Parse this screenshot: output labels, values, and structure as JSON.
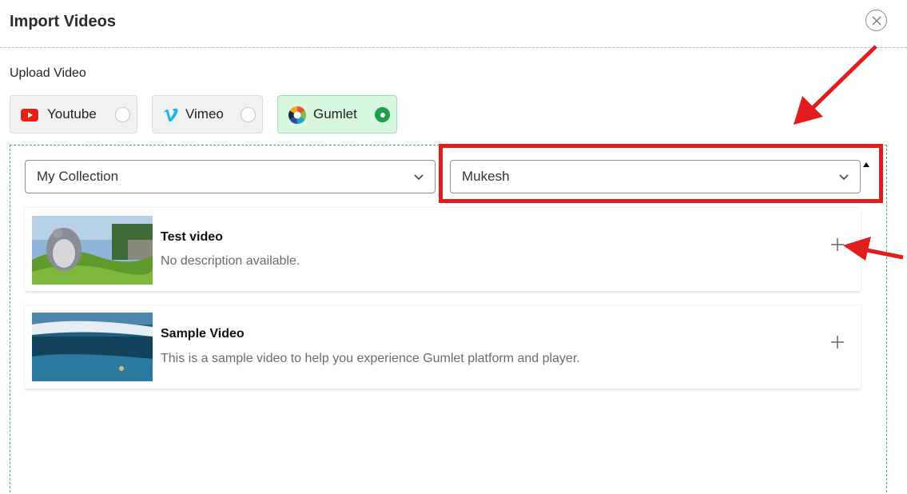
{
  "modal": {
    "title": "Import Videos",
    "close_icon": "close-icon"
  },
  "upload": {
    "label": "Upload Video",
    "sources": [
      {
        "label": "Youtube",
        "icon": "youtube-icon",
        "selected": false
      },
      {
        "label": "Vimeo",
        "icon": "vimeo-icon",
        "selected": false
      },
      {
        "label": "Gumlet",
        "icon": "gumlet-icon",
        "selected": true
      }
    ]
  },
  "filters": {
    "collection": "My Collection",
    "user": "Mukesh"
  },
  "videos": [
    {
      "title": "Test video",
      "description": "No description available."
    },
    {
      "title": "Sample Video",
      "description": "This is a sample video to help you experience Gumlet platform and player."
    }
  ],
  "colors": {
    "highlight": "#e11d1d",
    "accent_green": "#1f9e4a",
    "selected_bg": "#d7f7df",
    "youtube_red": "#e62117",
    "vimeo_blue": "#1ab7ea"
  }
}
